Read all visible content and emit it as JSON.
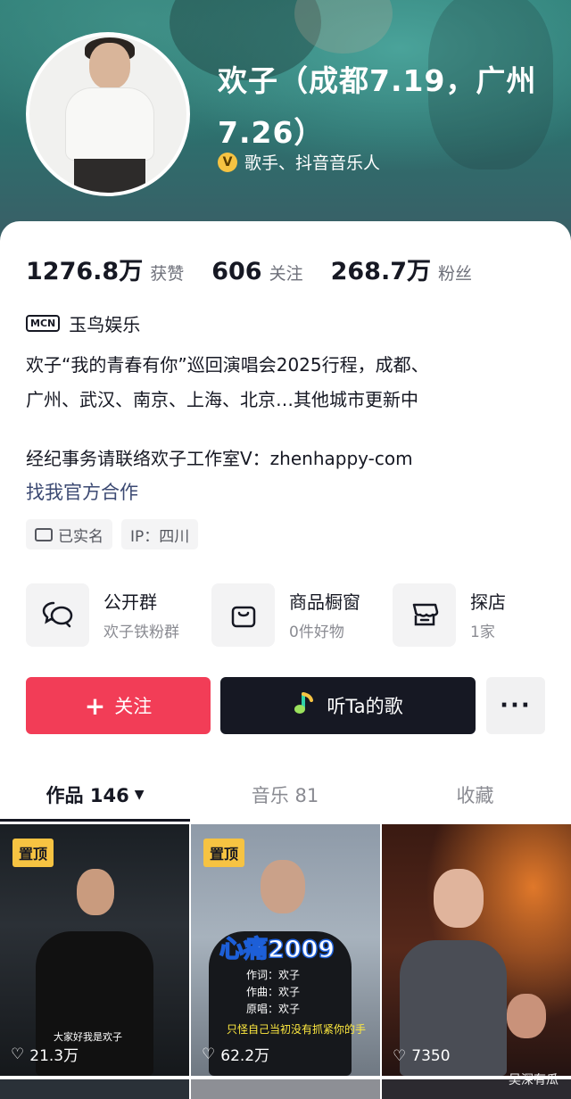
{
  "profile": {
    "name": "欢子（成都7.19，广州7.26）",
    "verification": "歌手、抖音音乐人",
    "verify_icon": "V"
  },
  "stats": {
    "likes_value": "1276.8万",
    "likes_label": "获赞",
    "following_value": "606",
    "following_label": "关注",
    "followers_value": "268.7万",
    "followers_label": "粉丝"
  },
  "mcn": {
    "badge": "MCN",
    "name": "玉鸟娱乐"
  },
  "bio": {
    "line1": "欢子“我的青春有你”巡回演唱会2025行程，成都、",
    "line2": "广州、武汉、南京、上海、北京…其他城市更新中",
    "contact": "经纪事务请联络欢子工作室V：zhenhappy-com",
    "official_link": "找我官方合作"
  },
  "tags": [
    {
      "icon": "id-card-icon",
      "label": "已实名"
    },
    {
      "label": "IP：四川"
    }
  ],
  "services": [
    {
      "icon": "chat-bubbles-icon",
      "title": "公开群",
      "subtitle": "欢子铁粉群"
    },
    {
      "icon": "shopping-bag-icon",
      "title": "商品橱窗",
      "subtitle": "0件好物"
    },
    {
      "icon": "store-icon",
      "title": "探店",
      "subtitle": "1家"
    }
  ],
  "actions": {
    "follow_label": "关注",
    "music_label": "听Ta的歌",
    "more_label": "···"
  },
  "tabs": [
    {
      "label": "作品 146",
      "active": true
    },
    {
      "label": "音乐 81",
      "active": false
    },
    {
      "label": "收藏",
      "active": false
    }
  ],
  "videos": [
    {
      "pinned": "置顶",
      "likes": "21.3万",
      "caption": "大家好我是欢子"
    },
    {
      "pinned": "置顶",
      "likes": "62.2万",
      "title": "心痛2009",
      "credits": [
        "作词：欢子",
        "作曲：欢子",
        "原唱：欢子"
      ],
      "lyric": "只怪自己当初没有抓紧你的手"
    },
    {
      "likes": "7350"
    }
  ],
  "watermark": "吴深有瓜",
  "colors": {
    "follow": "#f23d57",
    "dark": "#161823",
    "pin": "#f6c342",
    "link": "#3c4a73"
  }
}
